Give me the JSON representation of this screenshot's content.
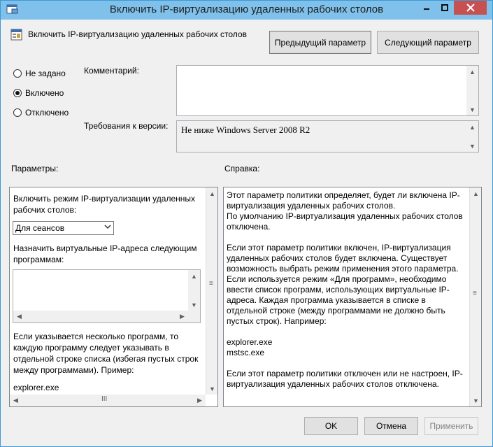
{
  "window": {
    "title": "Включить IP-виртуализацию удаленных рабочих столов",
    "controls": [
      "minimize",
      "maximize",
      "close"
    ]
  },
  "heading": {
    "text": "Включить IP-виртуализацию удаленных рабочих столов",
    "icon": "policy-settings-icon"
  },
  "nav": {
    "prev_label": "Предыдущий параметр",
    "next_label": "Следующий параметр"
  },
  "state": {
    "options": [
      {
        "label": "Не задано",
        "checked": false
      },
      {
        "label": "Включено",
        "checked": true
      },
      {
        "label": "Отключено",
        "checked": false
      }
    ]
  },
  "comment": {
    "label": "Комментарий:",
    "value": ""
  },
  "requirements": {
    "label": "Требования к версии:",
    "value": "Не ниже Windows Server 2008 R2"
  },
  "params": {
    "label": "Параметры:",
    "mode_label": "Включить режим IP-виртуализации удаленных рабочих столов:",
    "mode_value": "Для сеансов",
    "programs_label": "Назначить виртуальные IP-адреса следующим программам:",
    "programs_value": "",
    "note": "Если указывается несколько программ, то каждую программу следует указывать в отдельной строке списка (избегая пустых строк между программами). Пример:",
    "example": "explorer.exe"
  },
  "help": {
    "label": "Справка:",
    "text": "Этот параметр политики определяет, будет ли включена IP-виртуализация удаленных рабочих столов.\nПо умолчанию IP-виртуализация удаленных рабочих столов отключена.\n\nЕсли этот параметр политики включен, IP-виртуализация удаленных рабочих столов будет включена. Существует возможность выбрать режим применения этого параметра. Если используется режим «Для программ», необходимо ввести список программ, использующих виртуальные IP-адреса. Каждая программа указывается в списке в отдельной строке (между программами не должно быть пустых строк). Например:\n\nexplorer.exe\nmstsc.exe\n\nЕсли этот параметр политики отключен или не настроен, IP-виртуализация удаленных рабочих столов отключена."
  },
  "buttons": {
    "ok": "OK",
    "cancel": "Отмена",
    "apply": "Применить"
  },
  "colors": {
    "titlebar": "#7fc1ea",
    "close": "#c75050",
    "dialog_bg": "#f0f0f0"
  }
}
